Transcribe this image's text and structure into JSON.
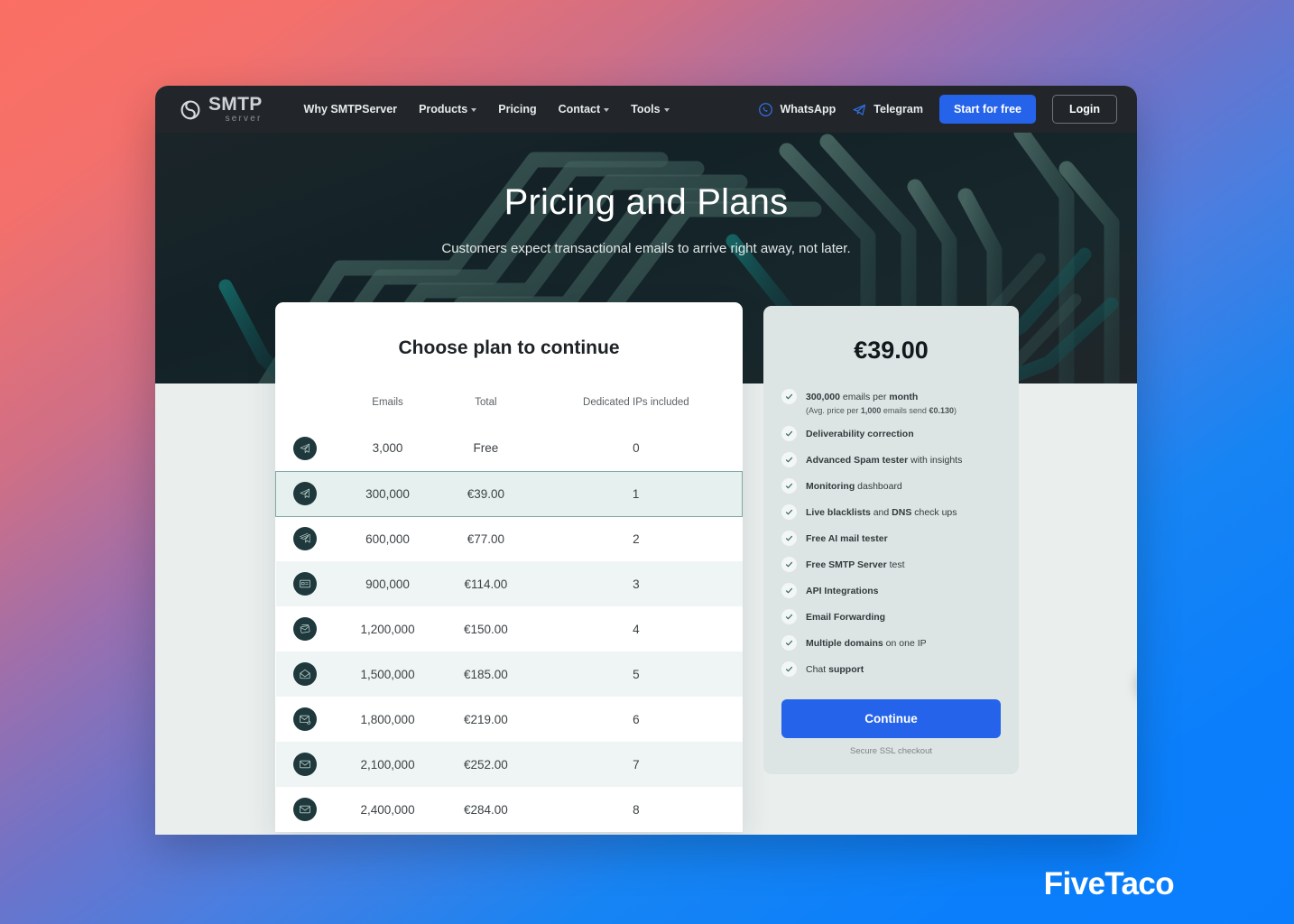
{
  "nav": {
    "logo_main": "SMTP",
    "logo_sub": "server",
    "links": [
      {
        "label": "Why SMTPServer",
        "caret": false
      },
      {
        "label": "Products",
        "caret": true
      },
      {
        "label": "Pricing",
        "caret": false
      },
      {
        "label": "Contact",
        "caret": true
      },
      {
        "label": "Tools",
        "caret": true
      }
    ],
    "whatsapp": "WhatsApp",
    "telegram": "Telegram",
    "start_label": "Start for free",
    "login_label": "Login",
    "accent": "#2563eb"
  },
  "hero": {
    "title": "Pricing and Plans",
    "subtitle": "Customers expect transactional emails to arrive right away, not later."
  },
  "plan_card": {
    "title": "Choose plan to continue",
    "columns": [
      "",
      "Emails",
      "Total",
      "Dedicated IPs included"
    ],
    "rows": [
      {
        "icon": "paper-plane-icon",
        "emails": "3,000",
        "total": "Free",
        "ips": "0",
        "selected": false
      },
      {
        "icon": "paper-plane-icon",
        "emails": "300,000",
        "total": "€39.00",
        "ips": "1",
        "selected": true
      },
      {
        "icon": "paper-planes-icon",
        "emails": "600,000",
        "total": "€77.00",
        "ips": "2",
        "selected": false
      },
      {
        "icon": "mail-card-icon",
        "emails": "900,000",
        "total": "€114.00",
        "ips": "3",
        "selected": false
      },
      {
        "icon": "mail-stack-icon",
        "emails": "1,200,000",
        "total": "€150.00",
        "ips": "4",
        "selected": false
      },
      {
        "icon": "envelope-open-icon",
        "emails": "1,500,000",
        "total": "€185.00",
        "ips": "5",
        "selected": false
      },
      {
        "icon": "envelope-refresh-icon",
        "emails": "1,800,000",
        "total": "€219.00",
        "ips": "6",
        "selected": false
      },
      {
        "icon": "envelope-icon",
        "emails": "2,100,000",
        "total": "€252.00",
        "ips": "7",
        "selected": false
      },
      {
        "icon": "envelope-icon",
        "emails": "2,400,000",
        "total": "€284.00",
        "ips": "8",
        "selected": false
      }
    ]
  },
  "feature_card": {
    "price": "€39.00",
    "features": [
      {
        "bold_first": "300,000",
        "rest": " emails per ",
        "bold_last": "month",
        "note_pre": "(Avg. price per ",
        "note_b1": "1,000",
        "note_mid": " emails send ",
        "note_b2": "€0.130",
        "note_post": ")"
      },
      {
        "bold_first": "Deliverability correction",
        "rest": "",
        "bold_last": ""
      },
      {
        "bold_first": "Advanced Spam tester",
        "rest": " with insights",
        "bold_last": ""
      },
      {
        "bold_first": "Monitoring",
        "rest": " dashboard",
        "bold_last": ""
      },
      {
        "bold_first": "Live blacklists",
        "rest": " and ",
        "bold_last": "DNS",
        "tail": " check ups"
      },
      {
        "bold_first": "Free AI mail tester",
        "rest": "",
        "bold_last": ""
      },
      {
        "bold_first": "Free SMTP Server",
        "rest": " test",
        "bold_last": ""
      },
      {
        "bold_first": "API Integrations",
        "rest": "",
        "bold_last": ""
      },
      {
        "bold_first": "Email Forwarding",
        "rest": "",
        "bold_last": ""
      },
      {
        "bold_first": "Multiple domains",
        "rest": " on one IP",
        "bold_last": ""
      },
      {
        "bold_first": "",
        "rest": "Chat ",
        "bold_last": "support"
      }
    ],
    "continue_label": "Continue",
    "ssl_note": "Secure SSL checkout"
  },
  "chat_fab": {
    "icon": "chat-help-icon"
  },
  "watermark": {
    "text": "FiveTaco"
  }
}
